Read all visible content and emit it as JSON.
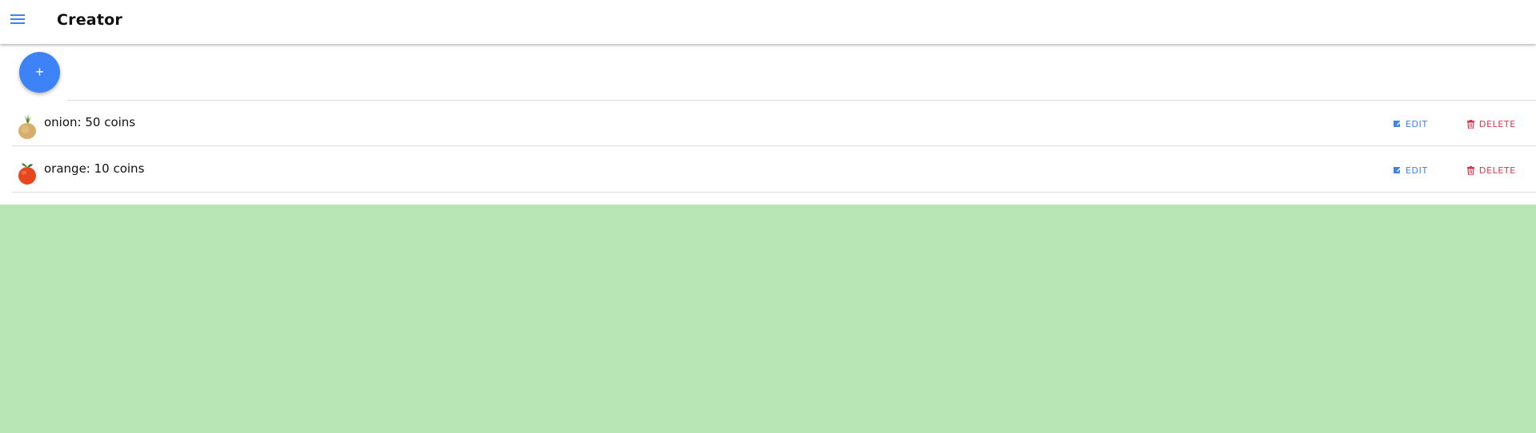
{
  "header": {
    "title": "Creator",
    "menu_icon": "hamburger-menu-icon"
  },
  "fab": {
    "label": "+",
    "icon": "plus-icon"
  },
  "colors": {
    "accent": "#3d82f6",
    "danger": "#e0344a",
    "page_background": "#b8e6b5"
  },
  "items": [
    {
      "icon": "onion-icon",
      "text": "onion: 50 coins",
      "edit_label": "EDIT",
      "delete_label": "DELETE"
    },
    {
      "icon": "orange-icon",
      "text": "orange: 10 coins",
      "edit_label": "EDIT",
      "delete_label": "DELETE"
    }
  ]
}
